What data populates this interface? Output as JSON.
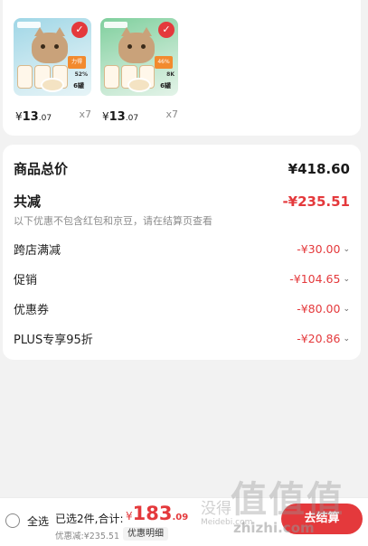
{
  "products": [
    {
      "thumb_theme": "blue",
      "promo": "力得",
      "percent": "52%",
      "pack": "6罐",
      "price_symbol": "¥",
      "price_int": "13",
      "price_dec": ".07",
      "quantity": "x7"
    },
    {
      "thumb_theme": "green",
      "promo": "46%",
      "percent": "8K",
      "pack": "6罐",
      "price_symbol": "¥",
      "price_int": "13",
      "price_dec": ".07",
      "quantity": "x7"
    }
  ],
  "summary": {
    "total_label": "商品总价",
    "total_value": "¥418.60",
    "discount_label": "共减",
    "discount_value": "-¥235.51",
    "note": "以下优惠不包含红包和京豆，请在结算页查看",
    "items": [
      {
        "label": "跨店满减",
        "value": "-¥30.00"
      },
      {
        "label": "促销",
        "value": "-¥104.65"
      },
      {
        "label": "优惠券",
        "value": "-¥80.00"
      },
      {
        "label": "PLUS专享95折",
        "value": "-¥20.86"
      }
    ]
  },
  "bottom_bar": {
    "select_all": "全选",
    "selected_text": "已选2件,合计:",
    "total_symbol": "¥",
    "total_int": "183",
    "total_dec": ".09",
    "saved_text": "优惠减:¥235.51",
    "detail_button": "优惠明细",
    "checkout_button": "去结算"
  },
  "watermark": {
    "main": "值值值",
    "left": "没得",
    "small": "Meidebi.com",
    "url": "zhizhi.com"
  },
  "colors": {
    "accent": "#e4393c",
    "muted": "#8c8c8c",
    "background": "#f2f2f2"
  },
  "icons": {
    "check": "check-badge-icon",
    "chevron": "chevron-down-icon",
    "radio": "radio-unchecked-icon"
  }
}
